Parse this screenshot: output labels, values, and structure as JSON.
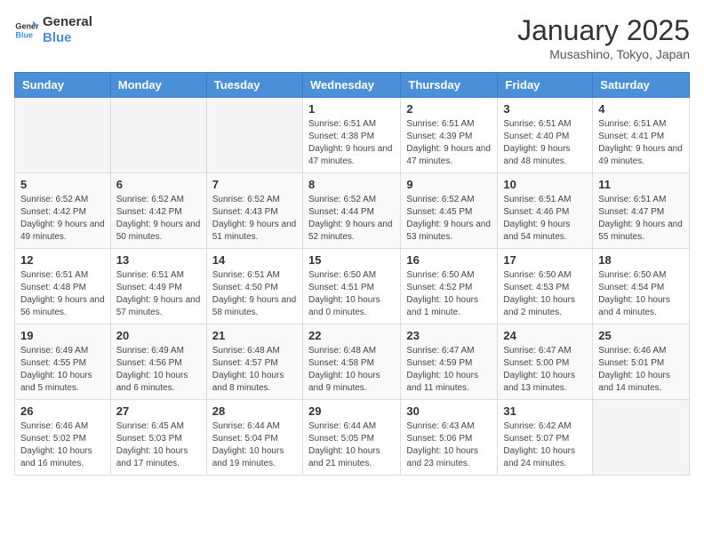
{
  "logo": {
    "text_general": "General",
    "text_blue": "Blue"
  },
  "header": {
    "title": "January 2025",
    "subtitle": "Musashino, Tokyo, Japan"
  },
  "weekdays": [
    "Sunday",
    "Monday",
    "Tuesday",
    "Wednesday",
    "Thursday",
    "Friday",
    "Saturday"
  ],
  "weeks": [
    [
      {
        "day": "",
        "info": ""
      },
      {
        "day": "",
        "info": ""
      },
      {
        "day": "",
        "info": ""
      },
      {
        "day": "1",
        "info": "Sunrise: 6:51 AM\nSunset: 4:38 PM\nDaylight: 9 hours and 47 minutes."
      },
      {
        "day": "2",
        "info": "Sunrise: 6:51 AM\nSunset: 4:39 PM\nDaylight: 9 hours and 47 minutes."
      },
      {
        "day": "3",
        "info": "Sunrise: 6:51 AM\nSunset: 4:40 PM\nDaylight: 9 hours and 48 minutes."
      },
      {
        "day": "4",
        "info": "Sunrise: 6:51 AM\nSunset: 4:41 PM\nDaylight: 9 hours and 49 minutes."
      }
    ],
    [
      {
        "day": "5",
        "info": "Sunrise: 6:52 AM\nSunset: 4:42 PM\nDaylight: 9 hours and 49 minutes."
      },
      {
        "day": "6",
        "info": "Sunrise: 6:52 AM\nSunset: 4:42 PM\nDaylight: 9 hours and 50 minutes."
      },
      {
        "day": "7",
        "info": "Sunrise: 6:52 AM\nSunset: 4:43 PM\nDaylight: 9 hours and 51 minutes."
      },
      {
        "day": "8",
        "info": "Sunrise: 6:52 AM\nSunset: 4:44 PM\nDaylight: 9 hours and 52 minutes."
      },
      {
        "day": "9",
        "info": "Sunrise: 6:52 AM\nSunset: 4:45 PM\nDaylight: 9 hours and 53 minutes."
      },
      {
        "day": "10",
        "info": "Sunrise: 6:51 AM\nSunset: 4:46 PM\nDaylight: 9 hours and 54 minutes."
      },
      {
        "day": "11",
        "info": "Sunrise: 6:51 AM\nSunset: 4:47 PM\nDaylight: 9 hours and 55 minutes."
      }
    ],
    [
      {
        "day": "12",
        "info": "Sunrise: 6:51 AM\nSunset: 4:48 PM\nDaylight: 9 hours and 56 minutes."
      },
      {
        "day": "13",
        "info": "Sunrise: 6:51 AM\nSunset: 4:49 PM\nDaylight: 9 hours and 57 minutes."
      },
      {
        "day": "14",
        "info": "Sunrise: 6:51 AM\nSunset: 4:50 PM\nDaylight: 9 hours and 58 minutes."
      },
      {
        "day": "15",
        "info": "Sunrise: 6:50 AM\nSunset: 4:51 PM\nDaylight: 10 hours and 0 minutes."
      },
      {
        "day": "16",
        "info": "Sunrise: 6:50 AM\nSunset: 4:52 PM\nDaylight: 10 hours and 1 minute."
      },
      {
        "day": "17",
        "info": "Sunrise: 6:50 AM\nSunset: 4:53 PM\nDaylight: 10 hours and 2 minutes."
      },
      {
        "day": "18",
        "info": "Sunrise: 6:50 AM\nSunset: 4:54 PM\nDaylight: 10 hours and 4 minutes."
      }
    ],
    [
      {
        "day": "19",
        "info": "Sunrise: 6:49 AM\nSunset: 4:55 PM\nDaylight: 10 hours and 5 minutes."
      },
      {
        "day": "20",
        "info": "Sunrise: 6:49 AM\nSunset: 4:56 PM\nDaylight: 10 hours and 6 minutes."
      },
      {
        "day": "21",
        "info": "Sunrise: 6:48 AM\nSunset: 4:57 PM\nDaylight: 10 hours and 8 minutes."
      },
      {
        "day": "22",
        "info": "Sunrise: 6:48 AM\nSunset: 4:58 PM\nDaylight: 10 hours and 9 minutes."
      },
      {
        "day": "23",
        "info": "Sunrise: 6:47 AM\nSunset: 4:59 PM\nDaylight: 10 hours and 11 minutes."
      },
      {
        "day": "24",
        "info": "Sunrise: 6:47 AM\nSunset: 5:00 PM\nDaylight: 10 hours and 13 minutes."
      },
      {
        "day": "25",
        "info": "Sunrise: 6:46 AM\nSunset: 5:01 PM\nDaylight: 10 hours and 14 minutes."
      }
    ],
    [
      {
        "day": "26",
        "info": "Sunrise: 6:46 AM\nSunset: 5:02 PM\nDaylight: 10 hours and 16 minutes."
      },
      {
        "day": "27",
        "info": "Sunrise: 6:45 AM\nSunset: 5:03 PM\nDaylight: 10 hours and 17 minutes."
      },
      {
        "day": "28",
        "info": "Sunrise: 6:44 AM\nSunset: 5:04 PM\nDaylight: 10 hours and 19 minutes."
      },
      {
        "day": "29",
        "info": "Sunrise: 6:44 AM\nSunset: 5:05 PM\nDaylight: 10 hours and 21 minutes."
      },
      {
        "day": "30",
        "info": "Sunrise: 6:43 AM\nSunset: 5:06 PM\nDaylight: 10 hours and 23 minutes."
      },
      {
        "day": "31",
        "info": "Sunrise: 6:42 AM\nSunset: 5:07 PM\nDaylight: 10 hours and 24 minutes."
      },
      {
        "day": "",
        "info": ""
      }
    ]
  ]
}
